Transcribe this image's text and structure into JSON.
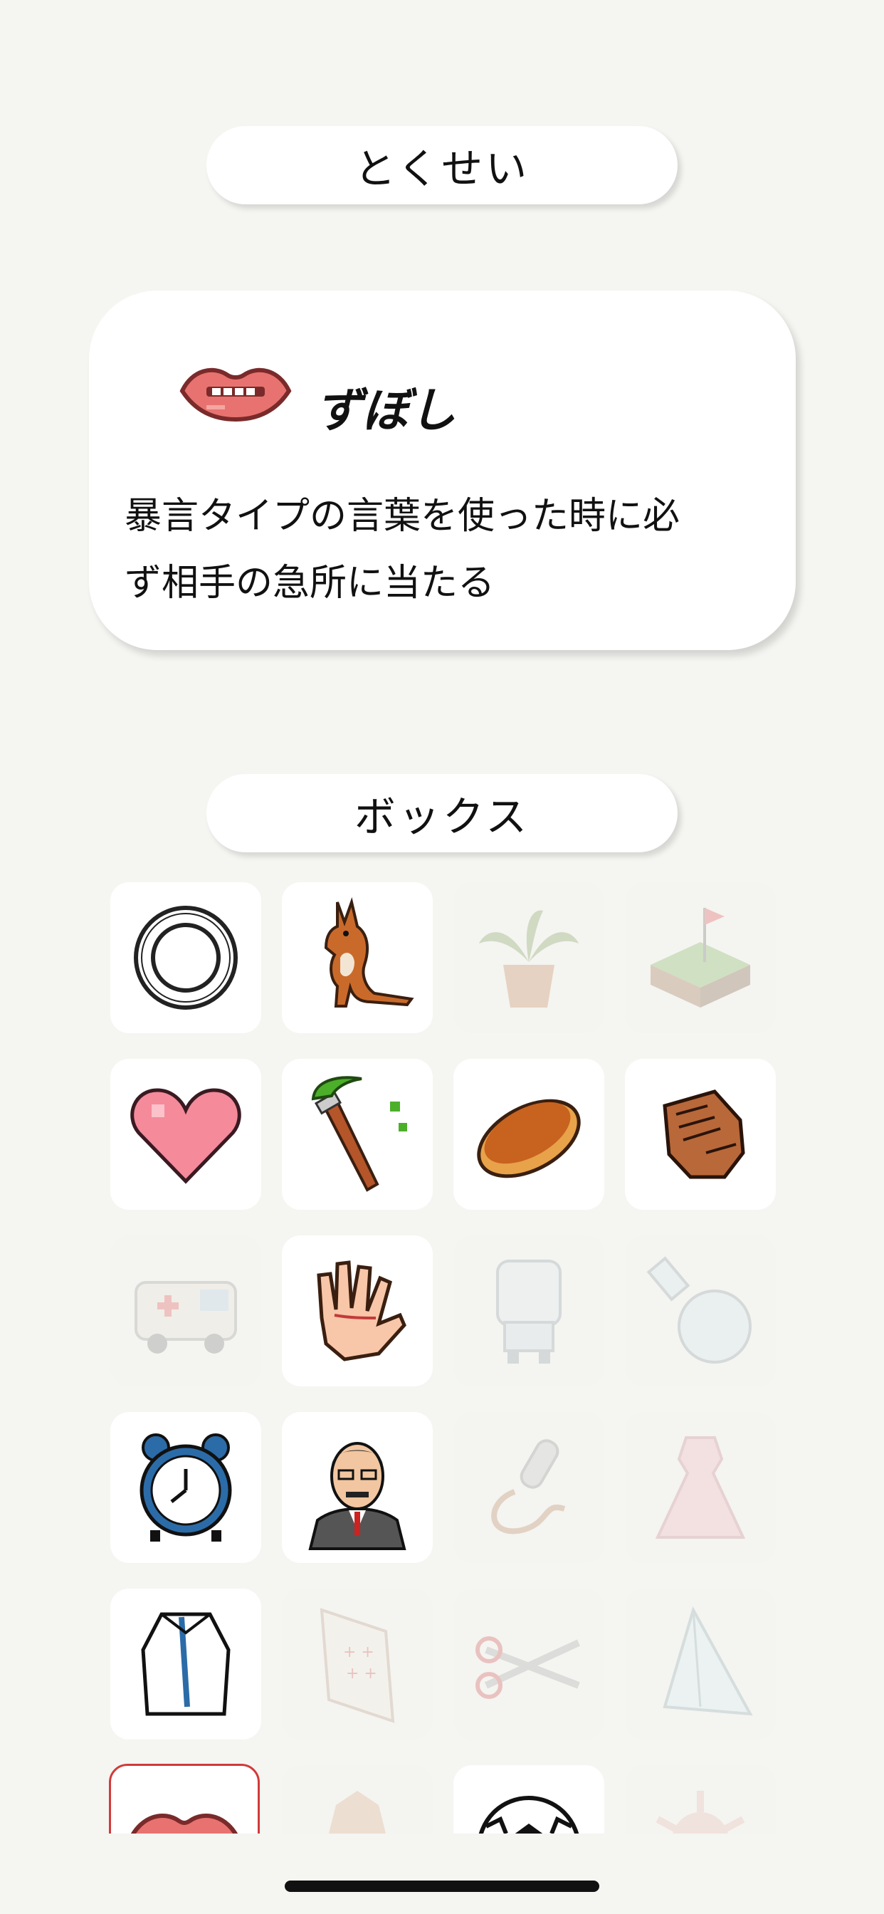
{
  "sections": {
    "trait_title": "とくせい",
    "box_title": "ボックス"
  },
  "trait": {
    "icon": "lips-icon",
    "name": "ずぼし",
    "description_lines": [
      "暴言タイプの言葉を使った時に必",
      "ず相手の急所に当たる"
    ]
  },
  "box_items": [
    {
      "icon": "ring-target-icon",
      "unlocked": true
    },
    {
      "icon": "kangaroo-icon",
      "unlocked": true
    },
    {
      "icon": "potted-plant-icon",
      "unlocked": false
    },
    {
      "icon": "golf-green-icon",
      "unlocked": false
    },
    {
      "icon": "heart-icon",
      "unlocked": true
    },
    {
      "icon": "paintbrush-icon",
      "unlocked": true
    },
    {
      "icon": "pancake-icon",
      "unlocked": true
    },
    {
      "icon": "fist-icon",
      "unlocked": true
    },
    {
      "icon": "ambulance-icon",
      "unlocked": false
    },
    {
      "icon": "hand-icon",
      "unlocked": true
    },
    {
      "icon": "robot-icon",
      "unlocked": false
    },
    {
      "icon": "flask-icon",
      "unlocked": false
    },
    {
      "icon": "alarm-clock-icon",
      "unlocked": true
    },
    {
      "icon": "businessman-icon",
      "unlocked": true
    },
    {
      "icon": "microphone-icon",
      "unlocked": false
    },
    {
      "icon": "dress-icon",
      "unlocked": false
    },
    {
      "icon": "shirt-icon",
      "unlocked": true
    },
    {
      "icon": "card-icon",
      "unlocked": false
    },
    {
      "icon": "scissors-icon",
      "unlocked": false
    },
    {
      "icon": "paper-plane-icon",
      "unlocked": false
    },
    {
      "icon": "lips-icon",
      "unlocked": true,
      "selected": true
    },
    {
      "icon": "rock-icon",
      "unlocked": false
    },
    {
      "icon": "soccer-ball-icon",
      "unlocked": true
    },
    {
      "icon": "virus-icon",
      "unlocked": false
    }
  ]
}
